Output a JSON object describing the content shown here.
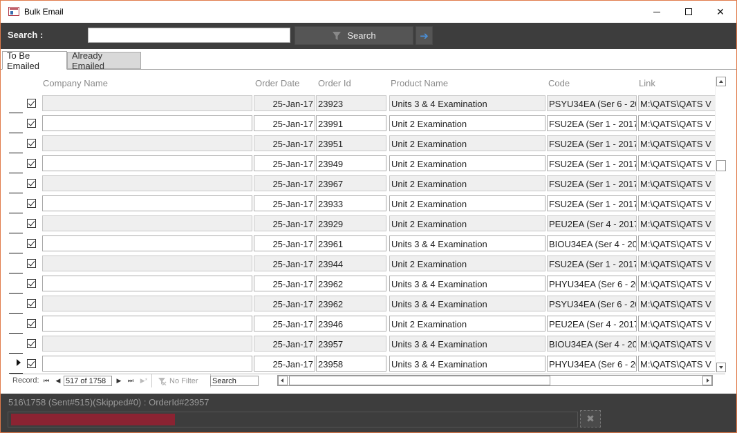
{
  "window": {
    "title": "Bulk Email",
    "minimize_glyph": "",
    "maximize_glyph": "",
    "close_glyph": "✕"
  },
  "search": {
    "label": "Search :",
    "value": "",
    "placeholder": "",
    "button_label": "Search",
    "go_glyph": "➔"
  },
  "tabs": [
    {
      "label": "To Be Emailed",
      "active": true
    },
    {
      "label": "Already Emailed",
      "active": false
    }
  ],
  "grid": {
    "columns": [
      "Company Name",
      "Order Date",
      "Order Id",
      "Product Name",
      "Code",
      "Link"
    ],
    "current_row_index": 13,
    "rows": [
      {
        "checked": true,
        "company": "",
        "order_date": "25-Jan-17",
        "order_id": "23923",
        "product": "Units 3 & 4 Examination",
        "code": "PSYU34EA (Ser 6 - 20",
        "link": "M:\\QATS\\QATS V"
      },
      {
        "checked": true,
        "company": "",
        "order_date": "25-Jan-17",
        "order_id": "23991",
        "product": "Unit 2 Examination",
        "code": "FSU2EA (Ser 1 - 2017",
        "link": "M:\\QATS\\QATS V"
      },
      {
        "checked": true,
        "company": "",
        "order_date": "25-Jan-17",
        "order_id": "23951",
        "product": "Unit 2 Examination",
        "code": "FSU2EA (Ser 1 - 2017",
        "link": "M:\\QATS\\QATS V"
      },
      {
        "checked": true,
        "company": "",
        "order_date": "25-Jan-17",
        "order_id": "23949",
        "product": "Unit 2 Examination",
        "code": "FSU2EA (Ser 1 - 2017",
        "link": "M:\\QATS\\QATS V"
      },
      {
        "checked": true,
        "company": "",
        "order_date": "25-Jan-17",
        "order_id": "23967",
        "product": "Unit 2 Examination",
        "code": "FSU2EA (Ser 1 - 2017",
        "link": "M:\\QATS\\QATS V"
      },
      {
        "checked": true,
        "company": "",
        "order_date": "25-Jan-17",
        "order_id": "23933",
        "product": "Unit 2 Examination",
        "code": "FSU2EA (Ser 1 - 2017",
        "link": "M:\\QATS\\QATS V"
      },
      {
        "checked": true,
        "company": "",
        "order_date": "25-Jan-17",
        "order_id": "23929",
        "product": "Unit 2 Examination",
        "code": "PEU2EA (Ser 4 - 2017",
        "link": "M:\\QATS\\QATS V"
      },
      {
        "checked": true,
        "company": "",
        "order_date": "25-Jan-17",
        "order_id": "23961",
        "product": "Units 3 & 4 Examination",
        "code": "BIOU34EA (Ser 4 - 20",
        "link": "M:\\QATS\\QATS V"
      },
      {
        "checked": true,
        "company": "",
        "order_date": "25-Jan-17",
        "order_id": "23944",
        "product": "Unit 2 Examination",
        "code": "FSU2EA (Ser 1 - 2017",
        "link": "M:\\QATS\\QATS V"
      },
      {
        "checked": true,
        "company": "",
        "order_date": "25-Jan-17",
        "order_id": "23962",
        "product": "Units 3 & 4 Examination",
        "code": "PHYU34EA (Ser 6 - 20",
        "link": "M:\\QATS\\QATS V"
      },
      {
        "checked": true,
        "company": "",
        "order_date": "25-Jan-17",
        "order_id": "23962",
        "product": "Units 3 & 4 Examination",
        "code": "PSYU34EA (Ser 6 - 20",
        "link": "M:\\QATS\\QATS V"
      },
      {
        "checked": true,
        "company": "",
        "order_date": "25-Jan-17",
        "order_id": "23946",
        "product": "Unit 2 Examination",
        "code": "PEU2EA (Ser 4 - 2017",
        "link": "M:\\QATS\\QATS V"
      },
      {
        "checked": true,
        "company": "",
        "order_date": "25-Jan-17",
        "order_id": "23957",
        "product": "Units 3 & 4 Examination",
        "code": "BIOU34EA (Ser 4 - 20",
        "link": "M:\\QATS\\QATS V"
      },
      {
        "checked": true,
        "company": "",
        "order_date": "25-Jan-17",
        "order_id": "23958",
        "product": "Units 3 & 4 Examination",
        "code": "PHYU34EA (Ser 6 - 20",
        "link": "M:\\QATS\\QATS V"
      }
    ]
  },
  "record_nav": {
    "label": "Record:",
    "position": "517 of 1758",
    "first_glyph": "⏮",
    "prev_glyph": "◀",
    "next_glyph": "▶",
    "last_glyph": "⏭",
    "new_glyph": "▶*",
    "filter_label": "No Filter",
    "search_value": "Search"
  },
  "status": {
    "text": "516\\1758 (Sent#515)(Skipped#0) : OrderId#23957",
    "progress_fraction": 0.29,
    "cancel_glyph": "✖"
  },
  "colors": {
    "toolbar_bg": "#3d3d3d",
    "progress_fill": "#8b2332",
    "window_border": "#e07a4a",
    "go_arrow": "#4a90d9"
  }
}
